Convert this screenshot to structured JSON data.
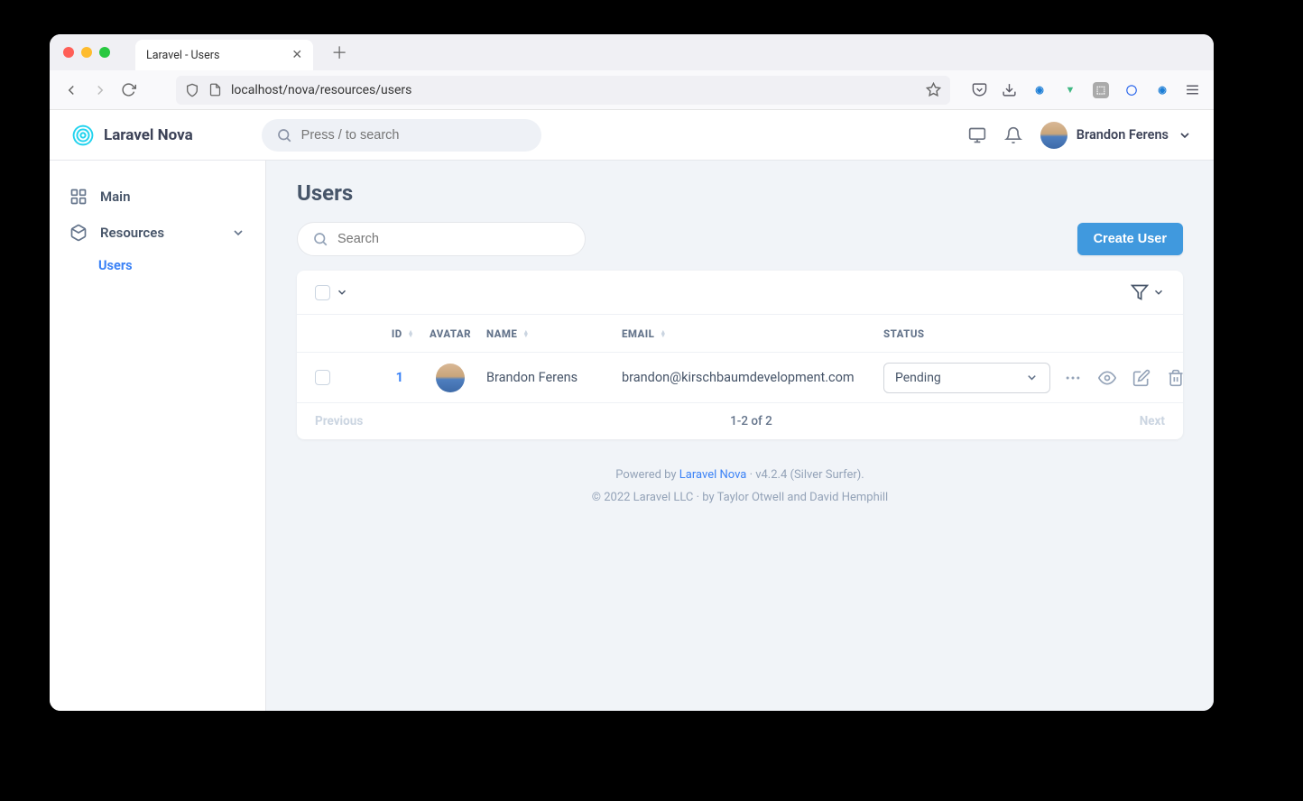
{
  "browser": {
    "tab_title": "Laravel - Users",
    "url": "localhost/nova/resources/users"
  },
  "header": {
    "logo_text": "Laravel Nova",
    "search_placeholder": "Press / to search",
    "user_name": "Brandon Ferens"
  },
  "sidebar": {
    "main_label": "Main",
    "resources_label": "Resources",
    "users_label": "Users"
  },
  "page": {
    "title": "Users",
    "search_placeholder": "Search",
    "create_label": "Create User"
  },
  "table": {
    "headers": {
      "id": "ID",
      "avatar": "AVATAR",
      "name": "NAME",
      "email": "EMAIL",
      "status": "STATUS"
    },
    "rows": [
      {
        "id": "1",
        "name": "Brandon Ferens",
        "email": "brandon@kirschbaumdevelopment.com",
        "status": "Pending"
      }
    ],
    "pager": {
      "prev": "Previous",
      "count": "1-2 of 2",
      "next": "Next"
    }
  },
  "footer": {
    "powered_prefix": "Powered by ",
    "powered_link": "Laravel Nova",
    "version": " · v4.2.4 (Silver Surfer).",
    "copyright": "© 2022 Laravel LLC · by Taylor Otwell and David Hemphill"
  }
}
